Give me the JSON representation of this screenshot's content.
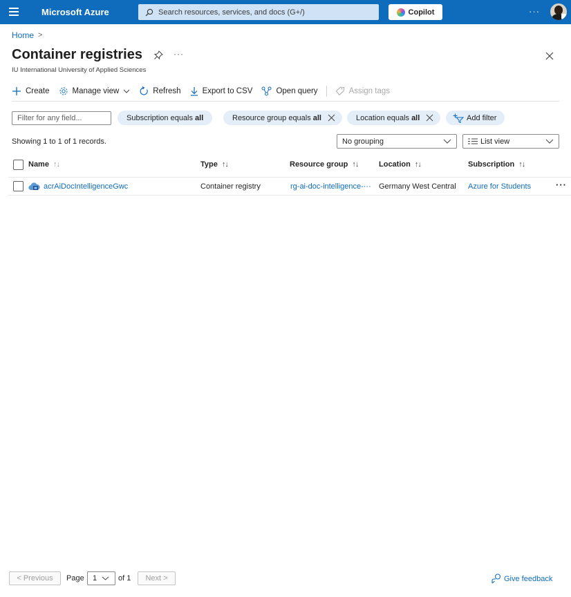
{
  "topbar": {
    "brand": "Microsoft Azure",
    "search_placeholder": "Search resources, services, and docs (G+/)",
    "copilot_label": "Copilot",
    "more": "···"
  },
  "header": {
    "breadcrumb_home": "Home",
    "breadcrumb_sep": ">",
    "title": "Container registries",
    "more": "···",
    "subtitle": "IU International University of Applied Sciences"
  },
  "toolbar": {
    "create": "Create",
    "manage_view": "Manage view",
    "refresh": "Refresh",
    "export_csv": "Export to CSV",
    "open_query": "Open query",
    "assign_tags": "Assign tags"
  },
  "filters": {
    "input_placeholder": "Filter for any field...",
    "subscription_prefix": "Subscription equals",
    "subscription_value": "all",
    "resource_group_prefix": "Resource group equals",
    "resource_group_value": "all",
    "location_prefix": "Location equals",
    "location_value": "all",
    "add_filter": "Add filter"
  },
  "records_text": "Showing 1 to 1 of 1 records.",
  "grouping": "No grouping",
  "view_mode": "List view",
  "table": {
    "columns": {
      "name": "Name",
      "type": "Type",
      "resource_group": "Resource group",
      "location": "Location",
      "subscription": "Subscription"
    },
    "sort_glyph": "↑↓",
    "rows": [
      {
        "name": "acrAiDocIntelligenceGwc",
        "type": "Container registry",
        "resource_group": "rg-ai-doc-intelligence-···",
        "location": "Germany West Central",
        "subscription": "Azure for Students",
        "more": "···"
      }
    ]
  },
  "footer": {
    "previous": "< Previous",
    "page_label": "Page",
    "page_value": "1",
    "of_label": "of 1",
    "next": "Next >",
    "feedback": "Give feedback"
  },
  "colors": {
    "brand_blue": "#0f6cbd",
    "pill_bg": "#e3eef9"
  },
  "icons": [
    "hamburger-icon",
    "search-icon",
    "copilot-icon",
    "pin-icon",
    "close-icon",
    "plus-icon",
    "gear-icon",
    "chevron-down-icon",
    "refresh-icon",
    "download-icon",
    "query-icon",
    "tag-icon",
    "add-filter-icon",
    "list-view-icon",
    "container-registry-icon",
    "feedback-icon"
  ]
}
